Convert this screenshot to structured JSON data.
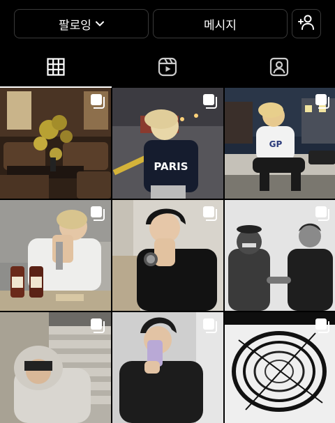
{
  "profile_actions": {
    "follow_label": "팔로잉",
    "message_label": "메시지",
    "add_user_icon": "add-user-icon"
  },
  "tabs": [
    {
      "icon": "grid-icon",
      "active": true
    },
    {
      "icon": "reels-icon",
      "active": false
    },
    {
      "icon": "tagged-icon",
      "active": false
    }
  ],
  "posts": [
    {
      "description": "cafe interior with flowers",
      "icon": "multi-photo-icon"
    },
    {
      "description": "man in PARIS t-shirt at night",
      "icon": "multi-photo-icon",
      "shirt_text": "PARIS"
    },
    {
      "description": "man sitting on steps",
      "icon": "multi-photo-icon",
      "shirt_text": "GP"
    },
    {
      "description": "man with bottles",
      "icon": "multi-photo-icon"
    },
    {
      "description": "man in black sweater",
      "icon": "multi-photo-icon"
    },
    {
      "description": "two men black and white",
      "icon": "multi-photo-icon"
    },
    {
      "description": "man in hoodie on stairs",
      "icon": "multi-photo-icon"
    },
    {
      "description": "mirror selfie",
      "icon": "multi-photo-icon"
    },
    {
      "description": "abstract wire sculpture",
      "icon": "multi-photo-icon"
    }
  ]
}
